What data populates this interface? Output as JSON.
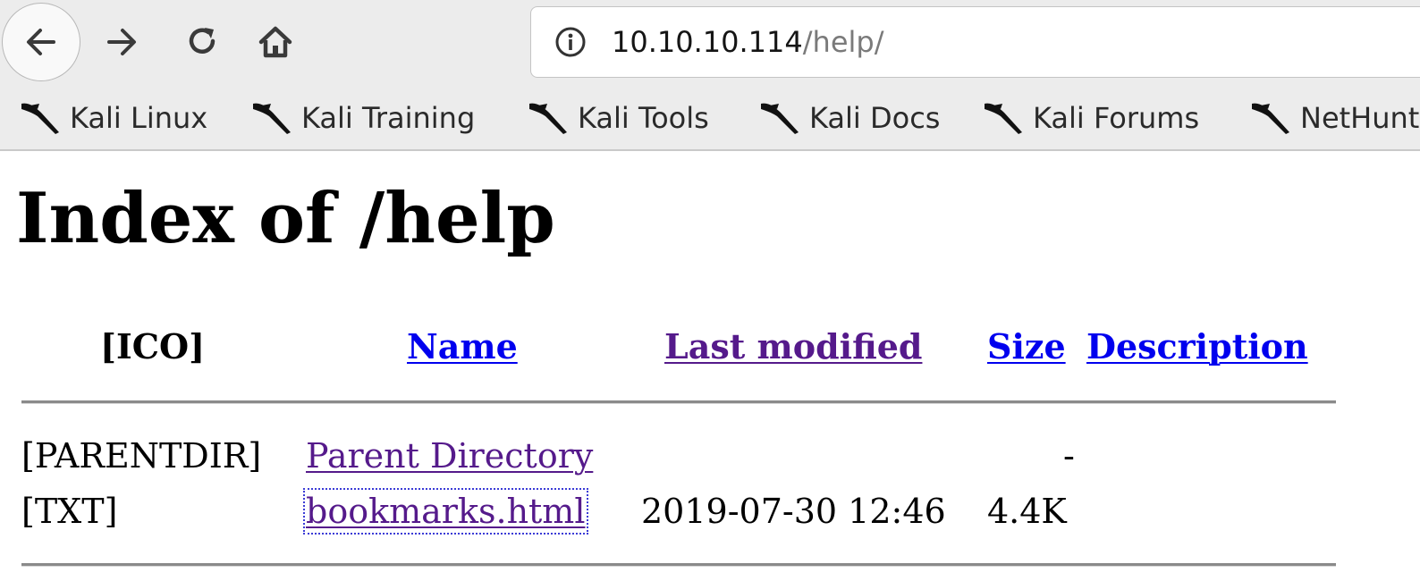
{
  "toolbar": {
    "back_icon": "arrow-left-icon",
    "forward_icon": "arrow-right-icon",
    "reload_icon": "reload-icon",
    "home_icon": "home-icon",
    "info_icon": "info-icon",
    "url_host": "10.10.10.114",
    "url_path": "/help/"
  },
  "bookmarks": {
    "icon": "kali-dragon-icon",
    "items": [
      "Kali Linux",
      "Kali Training",
      "Kali Tools",
      "Kali Docs",
      "Kali Forums",
      "NetHunter"
    ]
  },
  "page": {
    "title": "Index of /help",
    "columns": {
      "icon": "[ICO]",
      "name": "Name",
      "last_modified": "Last modified",
      "size": "Size",
      "description": "Description"
    },
    "rows": [
      {
        "icon": "[PARENTDIR]",
        "name": "Parent Directory",
        "last_modified": "",
        "size": "-",
        "description": ""
      },
      {
        "icon": "[TXT]",
        "name": "bookmarks.html",
        "last_modified": "2019-07-30 12:46",
        "size": "4.4K",
        "description": ""
      }
    ]
  },
  "colors": {
    "link": "#0000ee",
    "visited_link": "#551a8b",
    "chrome_bg": "#ececec"
  }
}
